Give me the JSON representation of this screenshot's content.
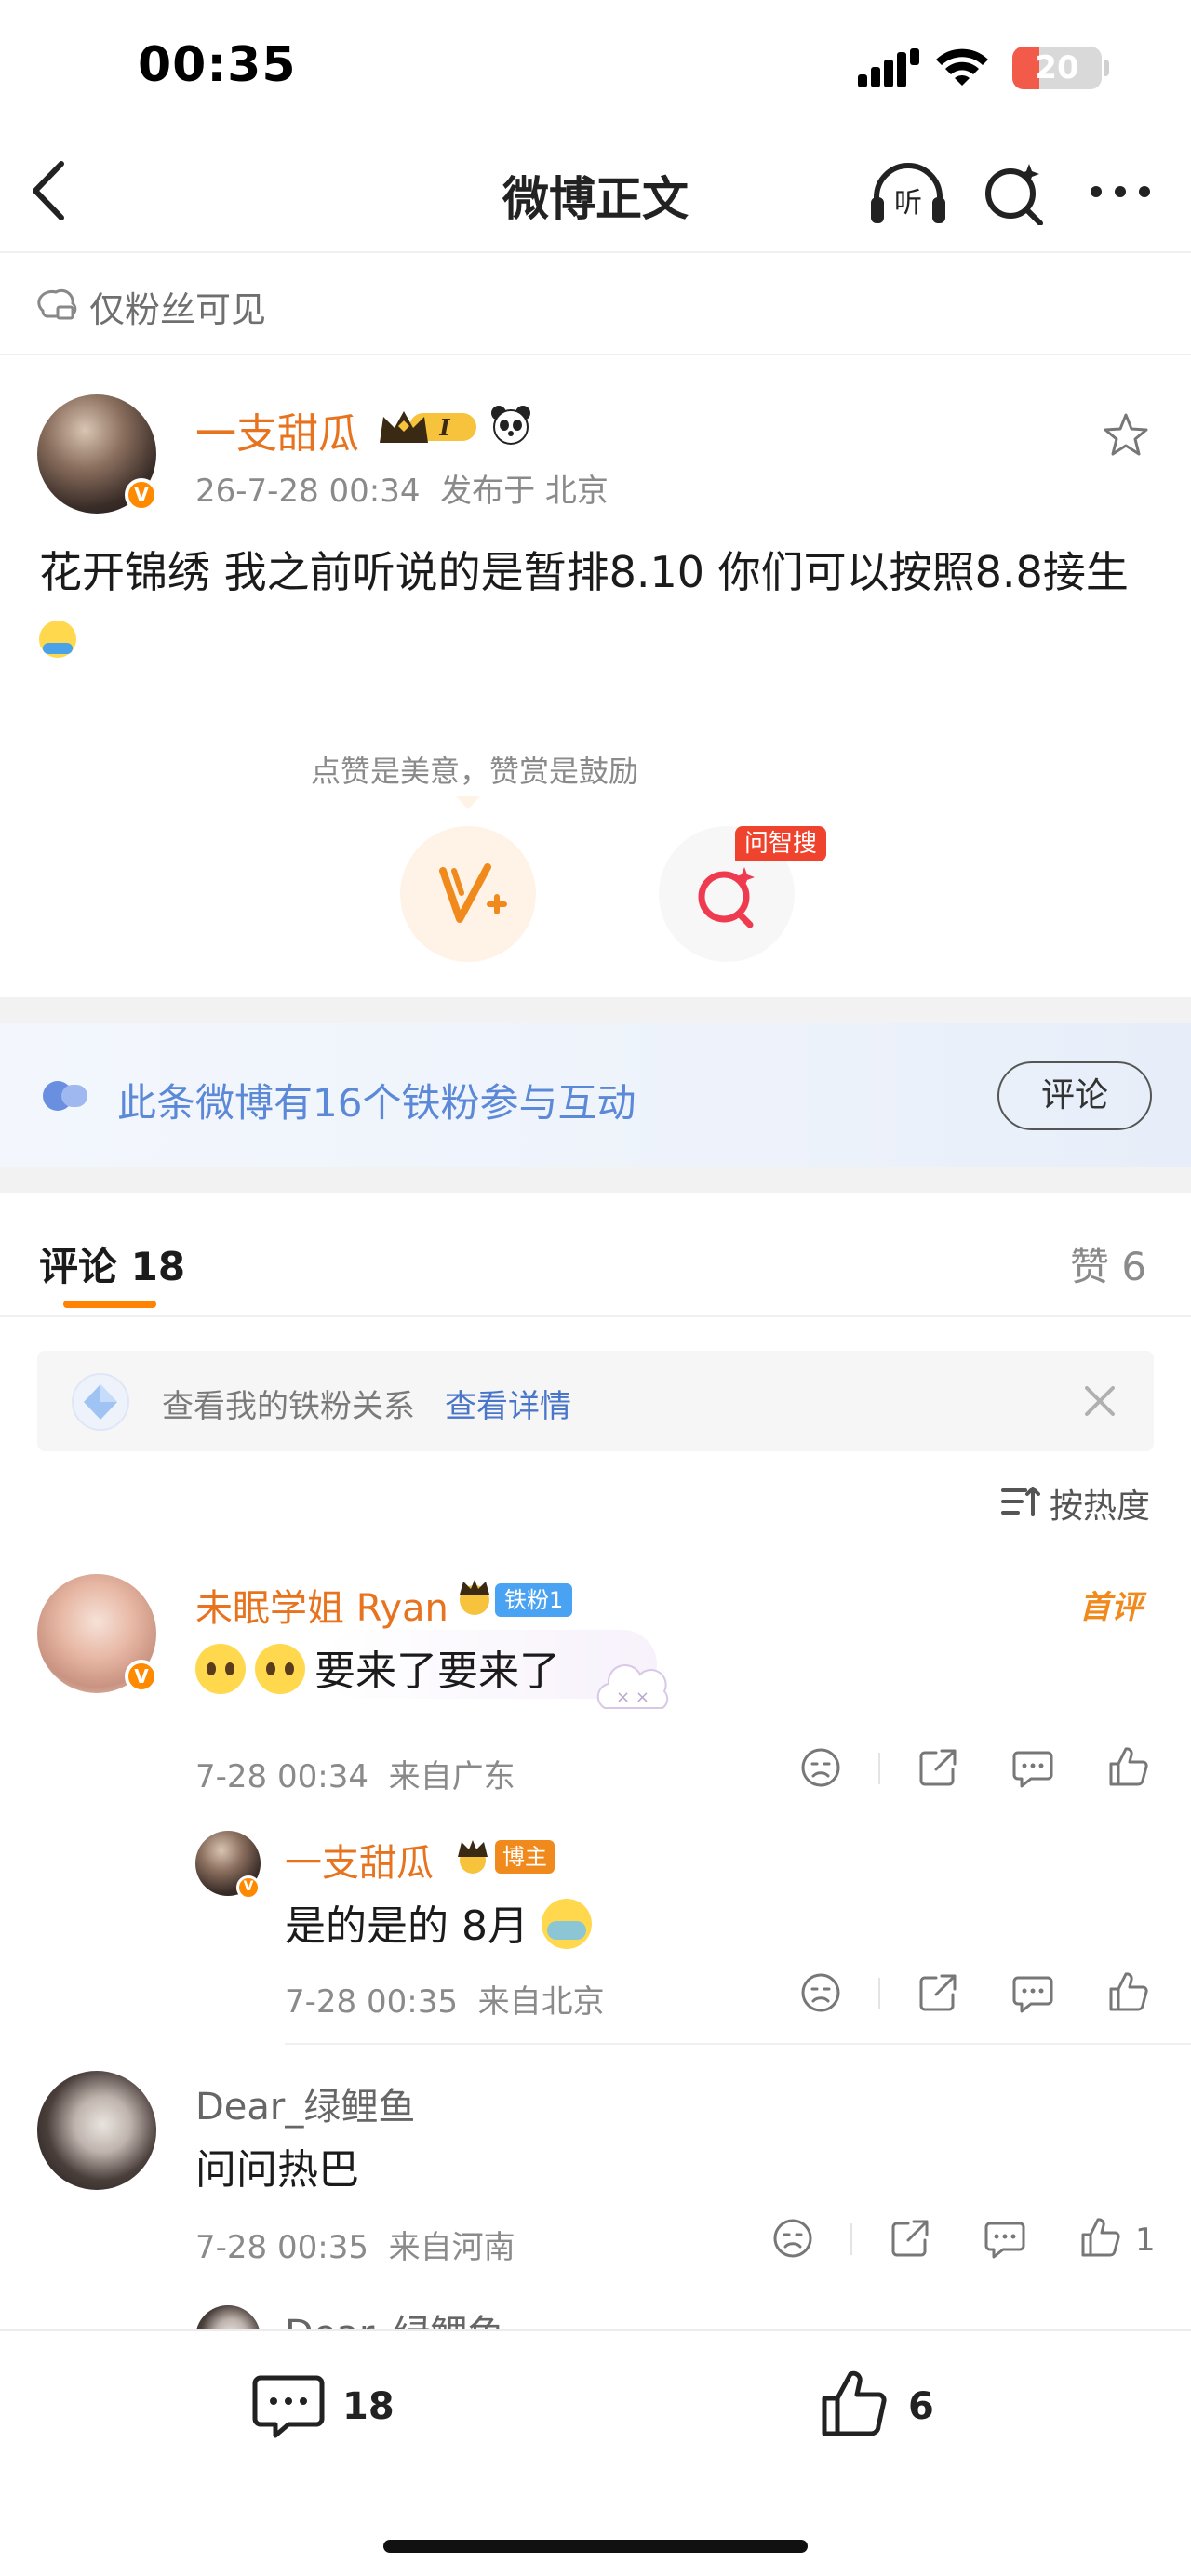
{
  "status_bar": {
    "time": "00:35",
    "battery": "20"
  },
  "nav": {
    "title": "微博正文"
  },
  "visibility": {
    "label": "仅粉丝可见"
  },
  "post": {
    "author": "一支甜瓜",
    "time": "26-7-28 00:34",
    "location": "发布于 北京",
    "text": "花开锦绣 我之前听说的是暂排8.10 你们可以按照8.8接生",
    "crown_level": "I"
  },
  "reward": {
    "tip": "点赞是美意，赞赏是鼓励",
    "ask_badge": "问智搜"
  },
  "fans_banner": {
    "text": "此条微博有16个铁粉参与互动",
    "button": "评论"
  },
  "tabs": {
    "comments": "评论 18",
    "likes": "赞 6"
  },
  "relation_card": {
    "text": "查看我的铁粉关系",
    "link": "查看详情"
  },
  "sort": {
    "label": "按热度"
  },
  "comments": [
    {
      "name": "未眠学姐 Ryan",
      "badge": "铁粉1",
      "tag": "首评",
      "text": "要来了要来了",
      "time": "7-28 00:34",
      "location": "来自广东",
      "reply": {
        "name": "一支甜瓜",
        "badge": "博主",
        "text": "是的是的 8月",
        "time": "7-28 00:35",
        "location": "来自北京"
      }
    },
    {
      "name": "Dear_绿鲤鱼",
      "text": "问问热巴",
      "time": "7-28 00:35",
      "location": "来自河南",
      "likes": "1",
      "reply_preview_name": "Dear_绿鲤鱼"
    }
  ],
  "bottom_bar": {
    "comment_count": "18",
    "like_count": "6"
  },
  "colors": {
    "accent": "#ff8200",
    "name": "#e8731f",
    "link": "#4a76c9",
    "banner_text": "#5b89d8"
  }
}
